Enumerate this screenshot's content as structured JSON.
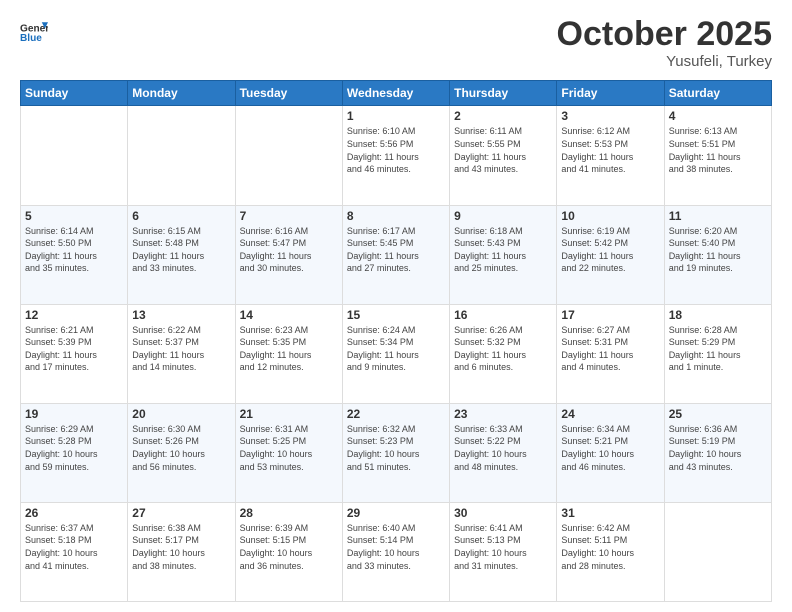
{
  "header": {
    "logo_general": "General",
    "logo_blue": "Blue",
    "month_title": "October 2025",
    "subtitle": "Yusufeli, Turkey"
  },
  "days_of_week": [
    "Sunday",
    "Monday",
    "Tuesday",
    "Wednesday",
    "Thursday",
    "Friday",
    "Saturday"
  ],
  "weeks": [
    [
      {
        "day": "",
        "info": ""
      },
      {
        "day": "",
        "info": ""
      },
      {
        "day": "",
        "info": ""
      },
      {
        "day": "1",
        "info": "Sunrise: 6:10 AM\nSunset: 5:56 PM\nDaylight: 11 hours\nand 46 minutes."
      },
      {
        "day": "2",
        "info": "Sunrise: 6:11 AM\nSunset: 5:55 PM\nDaylight: 11 hours\nand 43 minutes."
      },
      {
        "day": "3",
        "info": "Sunrise: 6:12 AM\nSunset: 5:53 PM\nDaylight: 11 hours\nand 41 minutes."
      },
      {
        "day": "4",
        "info": "Sunrise: 6:13 AM\nSunset: 5:51 PM\nDaylight: 11 hours\nand 38 minutes."
      }
    ],
    [
      {
        "day": "5",
        "info": "Sunrise: 6:14 AM\nSunset: 5:50 PM\nDaylight: 11 hours\nand 35 minutes."
      },
      {
        "day": "6",
        "info": "Sunrise: 6:15 AM\nSunset: 5:48 PM\nDaylight: 11 hours\nand 33 minutes."
      },
      {
        "day": "7",
        "info": "Sunrise: 6:16 AM\nSunset: 5:47 PM\nDaylight: 11 hours\nand 30 minutes."
      },
      {
        "day": "8",
        "info": "Sunrise: 6:17 AM\nSunset: 5:45 PM\nDaylight: 11 hours\nand 27 minutes."
      },
      {
        "day": "9",
        "info": "Sunrise: 6:18 AM\nSunset: 5:43 PM\nDaylight: 11 hours\nand 25 minutes."
      },
      {
        "day": "10",
        "info": "Sunrise: 6:19 AM\nSunset: 5:42 PM\nDaylight: 11 hours\nand 22 minutes."
      },
      {
        "day": "11",
        "info": "Sunrise: 6:20 AM\nSunset: 5:40 PM\nDaylight: 11 hours\nand 19 minutes."
      }
    ],
    [
      {
        "day": "12",
        "info": "Sunrise: 6:21 AM\nSunset: 5:39 PM\nDaylight: 11 hours\nand 17 minutes."
      },
      {
        "day": "13",
        "info": "Sunrise: 6:22 AM\nSunset: 5:37 PM\nDaylight: 11 hours\nand 14 minutes."
      },
      {
        "day": "14",
        "info": "Sunrise: 6:23 AM\nSunset: 5:35 PM\nDaylight: 11 hours\nand 12 minutes."
      },
      {
        "day": "15",
        "info": "Sunrise: 6:24 AM\nSunset: 5:34 PM\nDaylight: 11 hours\nand 9 minutes."
      },
      {
        "day": "16",
        "info": "Sunrise: 6:26 AM\nSunset: 5:32 PM\nDaylight: 11 hours\nand 6 minutes."
      },
      {
        "day": "17",
        "info": "Sunrise: 6:27 AM\nSunset: 5:31 PM\nDaylight: 11 hours\nand 4 minutes."
      },
      {
        "day": "18",
        "info": "Sunrise: 6:28 AM\nSunset: 5:29 PM\nDaylight: 11 hours\nand 1 minute."
      }
    ],
    [
      {
        "day": "19",
        "info": "Sunrise: 6:29 AM\nSunset: 5:28 PM\nDaylight: 10 hours\nand 59 minutes."
      },
      {
        "day": "20",
        "info": "Sunrise: 6:30 AM\nSunset: 5:26 PM\nDaylight: 10 hours\nand 56 minutes."
      },
      {
        "day": "21",
        "info": "Sunrise: 6:31 AM\nSunset: 5:25 PM\nDaylight: 10 hours\nand 53 minutes."
      },
      {
        "day": "22",
        "info": "Sunrise: 6:32 AM\nSunset: 5:23 PM\nDaylight: 10 hours\nand 51 minutes."
      },
      {
        "day": "23",
        "info": "Sunrise: 6:33 AM\nSunset: 5:22 PM\nDaylight: 10 hours\nand 48 minutes."
      },
      {
        "day": "24",
        "info": "Sunrise: 6:34 AM\nSunset: 5:21 PM\nDaylight: 10 hours\nand 46 minutes."
      },
      {
        "day": "25",
        "info": "Sunrise: 6:36 AM\nSunset: 5:19 PM\nDaylight: 10 hours\nand 43 minutes."
      }
    ],
    [
      {
        "day": "26",
        "info": "Sunrise: 6:37 AM\nSunset: 5:18 PM\nDaylight: 10 hours\nand 41 minutes."
      },
      {
        "day": "27",
        "info": "Sunrise: 6:38 AM\nSunset: 5:17 PM\nDaylight: 10 hours\nand 38 minutes."
      },
      {
        "day": "28",
        "info": "Sunrise: 6:39 AM\nSunset: 5:15 PM\nDaylight: 10 hours\nand 36 minutes."
      },
      {
        "day": "29",
        "info": "Sunrise: 6:40 AM\nSunset: 5:14 PM\nDaylight: 10 hours\nand 33 minutes."
      },
      {
        "day": "30",
        "info": "Sunrise: 6:41 AM\nSunset: 5:13 PM\nDaylight: 10 hours\nand 31 minutes."
      },
      {
        "day": "31",
        "info": "Sunrise: 6:42 AM\nSunset: 5:11 PM\nDaylight: 10 hours\nand 28 minutes."
      },
      {
        "day": "",
        "info": ""
      }
    ]
  ]
}
